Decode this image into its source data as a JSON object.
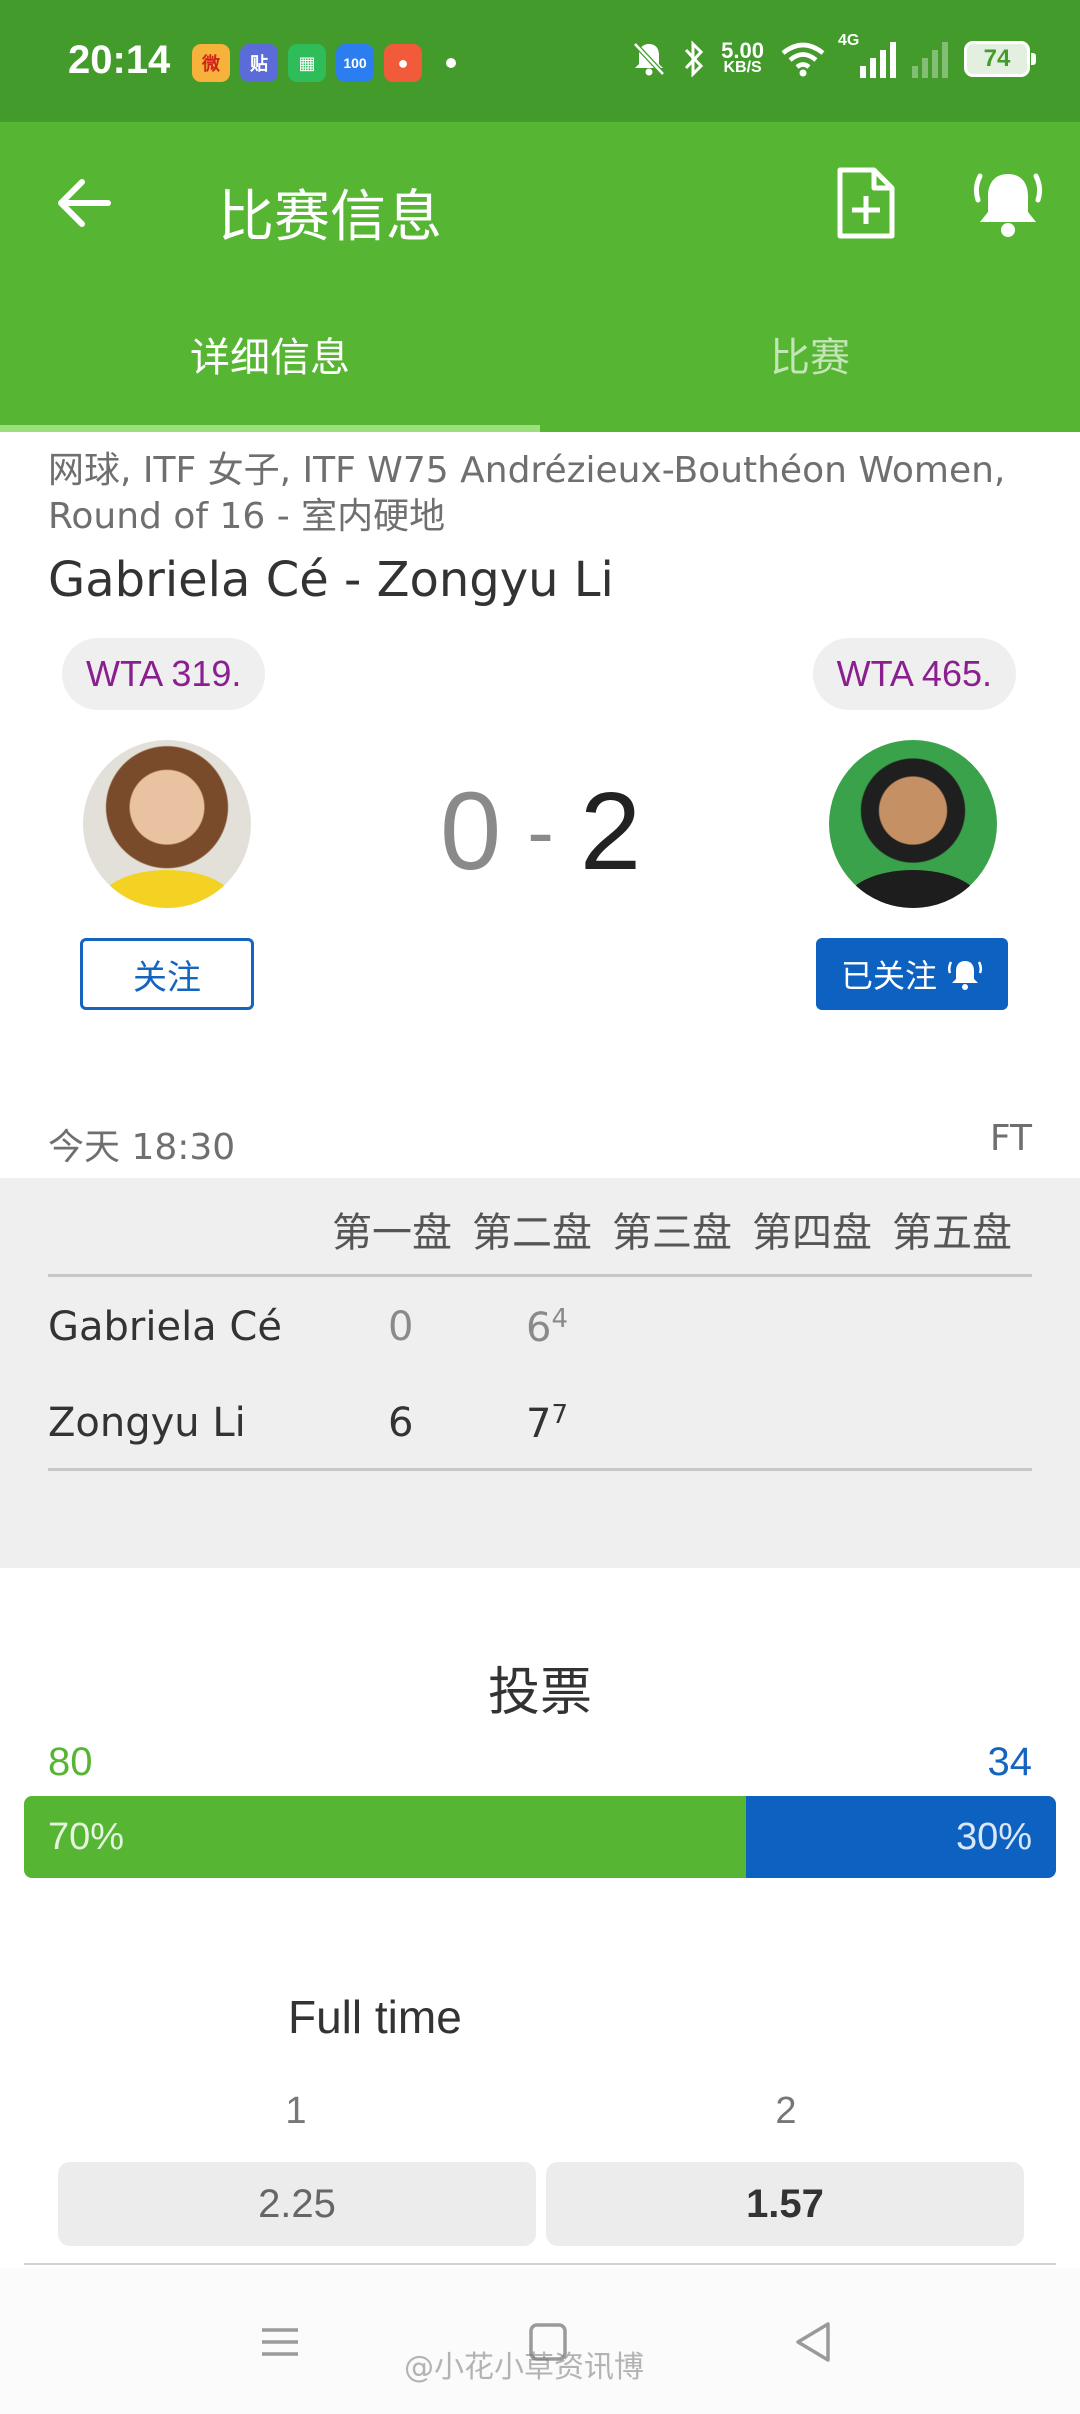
{
  "status_bar": {
    "time": "20:14",
    "app_icons": [
      "微",
      "贴",
      "▦",
      "100",
      "●"
    ],
    "net_speed_value": "5.00",
    "net_speed_unit": "KB/S",
    "network": "4G",
    "battery": "74"
  },
  "app_bar": {
    "title": "比赛信息"
  },
  "tabs": [
    {
      "label": "详细信息",
      "active": true
    },
    {
      "label": "比赛",
      "active": false
    }
  ],
  "match": {
    "meta": "网球, ITF 女子, ITF W75 Andrézieux-Bouthéon Women, Round of 16 - 室内硬地",
    "title": "Gabriela Cé - Zongyu Li",
    "home_rank": "WTA 319.",
    "away_rank": "WTA 465.",
    "home_score": "0",
    "separator": "-",
    "away_score": "2",
    "follow_label": "关注",
    "followed_label": "已关注",
    "time": "今天 18:30",
    "status": "FT"
  },
  "sets": {
    "headers": [
      "第一盘",
      "第二盘",
      "第三盘",
      "第四盘",
      "第五盘"
    ],
    "rows": [
      {
        "player": "Gabriela Cé",
        "set1": "0",
        "set2": "6",
        "set2_tb": "4"
      },
      {
        "player": "Zongyu Li",
        "set1": "6",
        "set2": "7",
        "set2_tb": "7"
      }
    ]
  },
  "vote": {
    "title": "投票",
    "home_count": "80",
    "away_count": "34",
    "home_pct_label": "70%",
    "away_pct_label": "30%",
    "home_fraction": 0.7
  },
  "odds": {
    "title": "Full time",
    "col1_label": "1",
    "col2_label": "2",
    "col1_value": "2.25",
    "col2_value": "1.57"
  },
  "watermark": "@小花小草资讯博",
  "colors": {
    "status_bar": "#439b2c",
    "app_bar": "#56b532",
    "home_accent": "#56b532",
    "away_accent": "#0d62c1",
    "rank_text": "#8b1f8f"
  }
}
